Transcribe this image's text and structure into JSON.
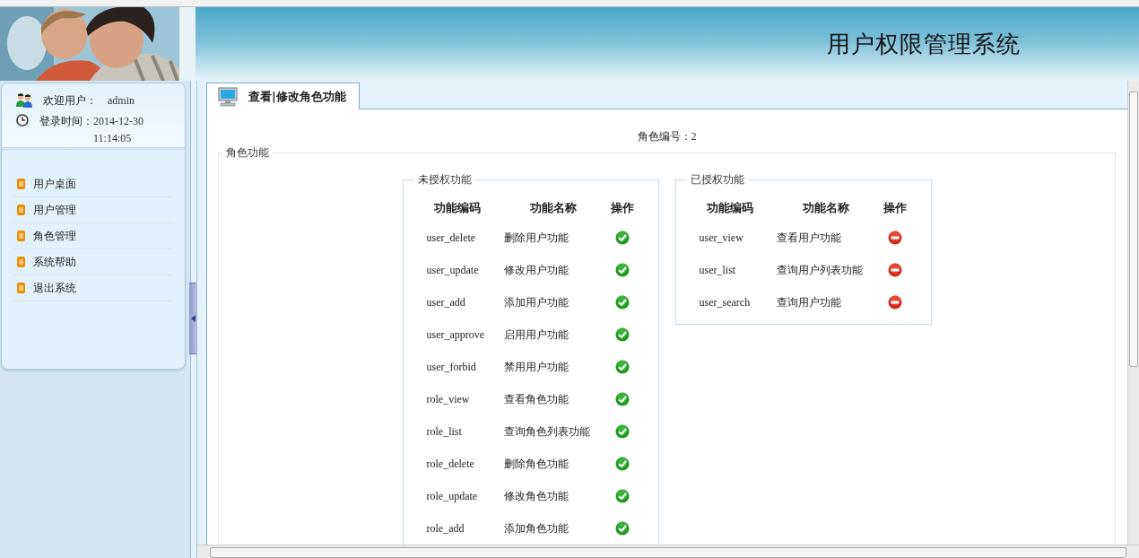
{
  "header": {
    "title": "用户权限管理系统"
  },
  "user_panel": {
    "welcome_label": "欢迎用户：",
    "username": "admin",
    "login_label": "登录时间：",
    "login_time": "2014-12-30 11:14:05"
  },
  "menu": [
    {
      "label": "用户桌面"
    },
    {
      "label": "用户管理"
    },
    {
      "label": "角色管理"
    },
    {
      "label": "系统帮助"
    },
    {
      "label": "退出系统"
    }
  ],
  "tabs": [
    {
      "label": "查看|修改角色功能",
      "selected": true
    }
  ],
  "role_number": {
    "label": "角色编号：",
    "value": "2"
  },
  "role_functions": {
    "legend": "角色功能",
    "groups": [
      {
        "legend": "未授权功能",
        "columns": [
          "功能编码",
          "功能名称",
          "操作"
        ],
        "rows": [
          {
            "code": "user_delete",
            "name": "删除用户功能",
            "kind": "grant"
          },
          {
            "code": "user_update",
            "name": "修改用户功能",
            "kind": "grant"
          },
          {
            "code": "user_add",
            "name": "添加用户功能",
            "kind": "grant"
          },
          {
            "code": "user_approve",
            "name": "启用用户功能",
            "kind": "grant"
          },
          {
            "code": "user_forbid",
            "name": "禁用用户功能",
            "kind": "grant"
          },
          {
            "code": "role_view",
            "name": "查看角色功能",
            "kind": "grant"
          },
          {
            "code": "role_list",
            "name": "查询角色列表功能",
            "kind": "grant"
          },
          {
            "code": "role_delete",
            "name": "删除角色功能",
            "kind": "grant"
          },
          {
            "code": "role_update",
            "name": "修改角色功能",
            "kind": "grant"
          },
          {
            "code": "role_add",
            "name": "添加角色功能",
            "kind": "grant"
          }
        ]
      },
      {
        "legend": "已授权功能",
        "columns": [
          "功能编码",
          "功能名称",
          "操作"
        ],
        "rows": [
          {
            "code": "user_view",
            "name": "查看用户功能",
            "kind": "revoke"
          },
          {
            "code": "user_list",
            "name": "查询用户列表功能",
            "kind": "revoke"
          },
          {
            "code": "user_search",
            "name": "查询用户功能",
            "kind": "revoke"
          }
        ]
      }
    ]
  }
}
